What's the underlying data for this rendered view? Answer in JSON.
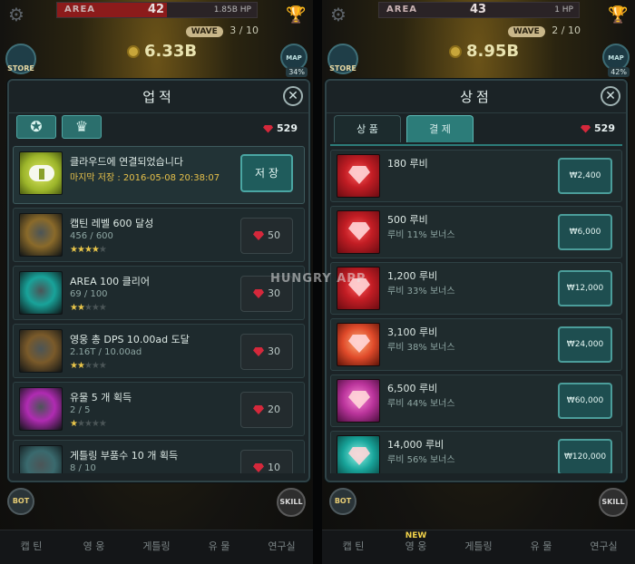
{
  "left": {
    "hud": {
      "area_label": "AREA",
      "area_num": "42",
      "hp": "1.85B HP",
      "wave_label": "WAVE",
      "wave_value": "3 / 10",
      "gold": "6.33B",
      "store": "STORE",
      "map": "MAP",
      "map_pct": "34%",
      "area_progress": 0.55
    },
    "panel": {
      "title": "업적",
      "close": "✕",
      "tab1_icon": "ribbon-icon",
      "tab2_icon": "crown-icon",
      "ruby": "529",
      "cloud": {
        "title": "클라우드에 연결되었습니다",
        "sub": "마지막 저장 : 2016-05-08 20:38:07",
        "button": "저 장"
      },
      "items": [
        {
          "title": "캡틴 레벨 600 달성",
          "progress": "456 / 600",
          "stars": 4,
          "reward": "50",
          "thumb": "#8a6a2a"
        },
        {
          "title": "AREA 100 클리어",
          "progress": "69 / 100",
          "stars": 2,
          "reward": "30",
          "thumb": "#18a39a"
        },
        {
          "title": "영웅 총 DPS 10.00ad 도달",
          "progress": "2.16T / 10.00ad",
          "stars": 2,
          "reward": "30",
          "thumb": "#7a5a2a"
        },
        {
          "title": "유물 5 개 획득",
          "progress": "2 / 5",
          "stars": 1,
          "reward": "20",
          "thumb": "#b02bb2"
        },
        {
          "title": "게틀링 부품수 10 개 획득",
          "progress": "8 / 10",
          "stars": 0,
          "reward": "10",
          "thumb": "#3a6a6e"
        }
      ]
    },
    "bot": "BOT",
    "skill": "SKILL",
    "nav": [
      "캡 틴",
      "영 웅",
      "게틀링",
      "유 물",
      "연구실"
    ]
  },
  "right": {
    "hud": {
      "area_label": "AREA",
      "area_num": "43",
      "hp": "1 HP",
      "wave_label": "WAVE",
      "wave_value": "2 / 10",
      "gold": "8.95B",
      "store": "STORE",
      "map": "MAP",
      "map_pct": "42%",
      "area_progress": 0.0
    },
    "panel": {
      "title": "상점",
      "close": "✕",
      "tab_goods": "상 품",
      "tab_pay": "결 제",
      "ruby": "529",
      "items": [
        {
          "title": "180 루비",
          "bonus": "",
          "price": "₩2,400",
          "tone": "red"
        },
        {
          "title": "500 루비",
          "bonus": "루비 11% 보너스",
          "price": "₩6,000",
          "tone": "red"
        },
        {
          "title": "1,200 루비",
          "bonus": "루비 33% 보너스",
          "price": "₩12,000",
          "tone": "red"
        },
        {
          "title": "3,100 루비",
          "bonus": "루비 38% 보너스",
          "price": "₩24,000",
          "tone": "orange"
        },
        {
          "title": "6,500 루비",
          "bonus": "루비 44% 보너스",
          "price": "₩60,000",
          "tone": "pink"
        },
        {
          "title": "14,000 루비",
          "bonus": "루비 56% 보너스",
          "price": "₩120,000",
          "tone": "teal"
        }
      ]
    },
    "bot": "BOT",
    "skill": "SKILL",
    "nav": [
      "캡 틴",
      "영 웅",
      "게틀링",
      "유 물",
      "연구실"
    ],
    "new_badge": "NEW"
  },
  "watermark": "HUNGRY APP"
}
